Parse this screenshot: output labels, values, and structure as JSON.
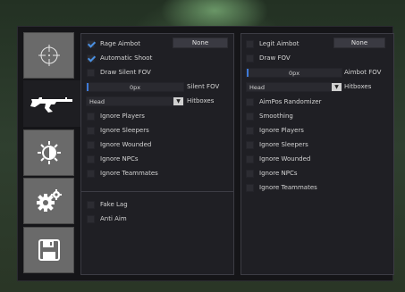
{
  "sidebar": {
    "tabs": [
      {
        "icon": "crosshair-icon",
        "active": false
      },
      {
        "icon": "rifle-icon",
        "active": true
      },
      {
        "icon": "brightness-icon",
        "active": false
      },
      {
        "icon": "gears-icon",
        "active": false
      },
      {
        "icon": "floppy-disk-icon",
        "active": false
      }
    ]
  },
  "colors": {
    "accent": "#4a8fe0",
    "panel": "#1f1f24",
    "frame": "#151518"
  },
  "left": {
    "rage_aimbot": {
      "label": "Rage Aimbot",
      "checked": true,
      "key": "None"
    },
    "automatic_shoot": {
      "label": "Automatic Shoot",
      "checked": true
    },
    "draw_silent_fov": {
      "label": "Draw Silent FOV",
      "checked": false
    },
    "silent_fov": {
      "label": "Silent FOV",
      "value": "0px",
      "fraction": 0.0
    },
    "hitboxes": {
      "label": "Hitboxes",
      "selected": "Head"
    },
    "options": [
      {
        "label": "Ignore Players"
      },
      {
        "label": "Ignore Sleepers"
      },
      {
        "label": "Ignore Wounded"
      },
      {
        "label": "Ignore NPCs"
      },
      {
        "label": "Ignore Teammates"
      }
    ],
    "misc": [
      {
        "label": "Fake Lag"
      },
      {
        "label": "Anti Aim"
      }
    ]
  },
  "right": {
    "legit_aimbot": {
      "label": "Legit Aimbot",
      "checked": false,
      "key": "None"
    },
    "draw_fov": {
      "label": "Draw FOV",
      "checked": false
    },
    "aimbot_fov": {
      "label": "Aimbot FOV",
      "value": "0px",
      "fraction": 0.0
    },
    "hitboxes": {
      "label": "Hitboxes",
      "selected": "Head"
    },
    "options": [
      {
        "label": "AimPos Randomizer"
      },
      {
        "label": "Smoothing"
      },
      {
        "label": "Ignore Players"
      },
      {
        "label": "Ignore Sleepers"
      },
      {
        "label": "Ignore Wounded"
      },
      {
        "label": "Ignore NPCs"
      },
      {
        "label": "Ignore Teammates"
      }
    ]
  }
}
